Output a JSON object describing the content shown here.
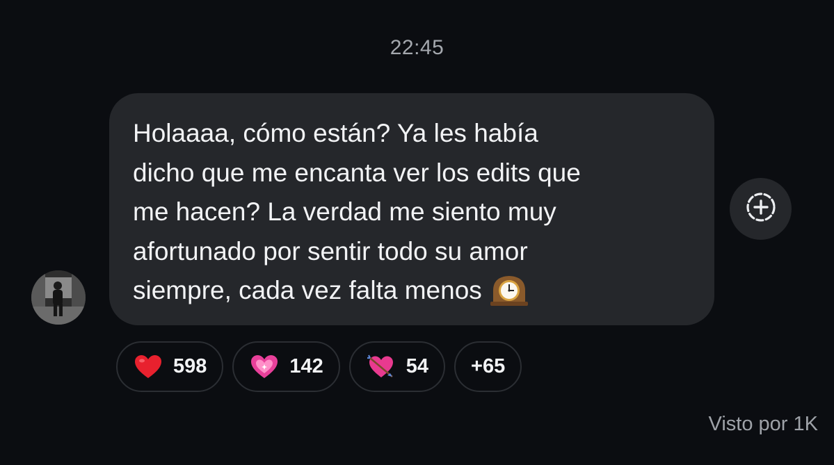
{
  "chat": {
    "timestamp": "22:45",
    "message": {
      "text": "Holaaaa, cómo están? Ya les había\ndicho que me encanta ver los edits que\nme hacen? La verdad me siento muy\nafortunado por sentir todo su amor\nsiempre, cada vez falta menos",
      "trailing_emoji": "mantelpiece-clock-icon"
    },
    "reactions": [
      {
        "emoji": "red-heart-icon",
        "count": "598"
      },
      {
        "emoji": "sparkling-heart-icon",
        "count": "142"
      },
      {
        "emoji": "heart-with-arrow-icon",
        "count": "54"
      }
    ],
    "more_reactions": "+65",
    "seen_by": "Visto por 1K"
  },
  "colors": {
    "background": "#0b0d11",
    "bubble": "#25272b",
    "text": "#f2f3f5",
    "muted": "#a4a8ae"
  }
}
